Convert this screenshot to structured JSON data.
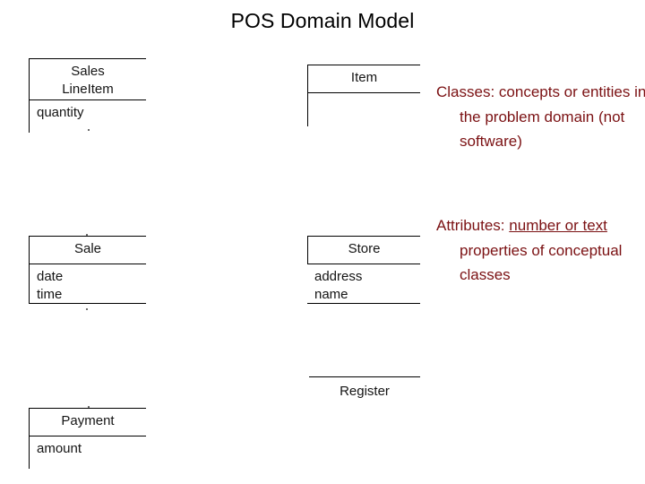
{
  "slide": {
    "title": "POS Domain Model",
    "title_color": "#000000",
    "background": "#ffffff",
    "note_color": "#7b1113",
    "diagram_line_color": "#000000"
  },
  "diagram": {
    "type": "uml-class-diagram",
    "classes": [
      {
        "id": "sales-lineitem",
        "name_lines": [
          "Sales",
          "LineItem"
        ],
        "name_line_1": "Sales",
        "name_line_2": "LineItem",
        "attributes": [
          "quantity"
        ],
        "attribute_1": "quantity"
      },
      {
        "id": "item",
        "name_lines": [
          "Item"
        ],
        "name_line_1": "Item",
        "attributes": [],
        "attribute_1": ""
      },
      {
        "id": "sale",
        "name_lines": [
          "Sale"
        ],
        "name_line_1": "Sale",
        "attributes": [
          "date",
          "time"
        ],
        "attribute_1": "date",
        "attribute_2": "time"
      },
      {
        "id": "store",
        "name_lines": [
          "Store"
        ],
        "name_line_1": "Store",
        "attributes": [
          "address",
          "name"
        ],
        "attribute_1": "address",
        "attribute_2": "name"
      },
      {
        "id": "register",
        "name_lines": [
          "Register"
        ],
        "name_line_1": "Register",
        "attributes": [],
        "attribute_1": ""
      },
      {
        "id": "payment",
        "name_lines": [
          "Payment"
        ],
        "name_line_1": "Payment",
        "attributes": [
          "amount"
        ],
        "attribute_1": "amount"
      }
    ]
  },
  "notes": {
    "classes": {
      "lead": "Classes:",
      "body": " concepts or entities in the problem domain (not software)",
      "full": "Classes: concepts or entities in the problem domain (not software)"
    },
    "attributes": {
      "lead": "Attributes:",
      "emphasis": "number or text",
      "body_before": " ",
      "body_after": " properties of conceptual classes",
      "full": "Attributes: number or text properties of conceptual classes"
    }
  }
}
